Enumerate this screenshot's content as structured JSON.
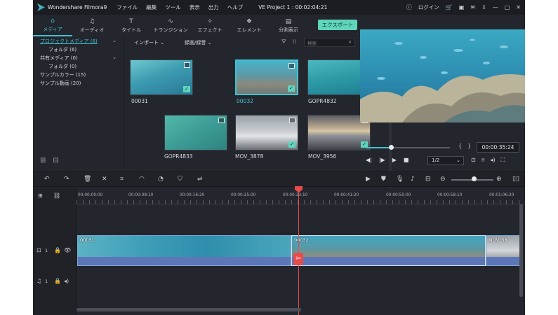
{
  "app": {
    "name": "Wondershare Filmora9",
    "project": "VE Project 1 : 00:02:04:21"
  },
  "menu": [
    "ファイル",
    "編集",
    "ツール",
    "表示",
    "出力",
    "ヘルプ"
  ],
  "titlebar_right": {
    "login": "ログイン"
  },
  "media_tabs": [
    {
      "label": "メディア",
      "icon": "folder-icon"
    },
    {
      "label": "オーディオ",
      "icon": "music-note-icon"
    },
    {
      "label": "タイトル",
      "icon": "text-icon"
    },
    {
      "label": "トランジション",
      "icon": "transition-icon"
    },
    {
      "label": "エフェクト",
      "icon": "effect-icon"
    },
    {
      "label": "エレメント",
      "icon": "element-icon"
    },
    {
      "label": "分割表示",
      "icon": "split-screen-icon"
    }
  ],
  "export_label": "エクスポート",
  "library": [
    {
      "label": "プロジェクトメディア (6)",
      "selected": true,
      "sub": false
    },
    {
      "label": "フォルダ (6)",
      "selected": false,
      "sub": true
    },
    {
      "label": "共有メディア (0)",
      "selected": false,
      "sub": false
    },
    {
      "label": "フォルダ (0)",
      "selected": false,
      "sub": true
    },
    {
      "label": "サンプルカラー (15)",
      "selected": false,
      "sub": false
    },
    {
      "label": "サンプル動画 (20)",
      "selected": false,
      "sub": false
    }
  ],
  "browser": {
    "import_label": "インポート",
    "record_label": "録画/録音",
    "search_placeholder": "検索",
    "items": [
      {
        "name": "00031",
        "selected": false,
        "checked": true,
        "theme": "underwater-divers"
      },
      {
        "name": "00032",
        "selected": true,
        "checked": true,
        "theme": "coral-reef"
      },
      {
        "name": "GOPR4832",
        "selected": false,
        "checked": false,
        "theme": "turquoise-water"
      },
      {
        "name": "GOPR4833",
        "selected": false,
        "checked": false,
        "theme": "shallow-reef"
      },
      {
        "name": "MOV_3878",
        "selected": false,
        "checked": true,
        "theme": "clouds-mountains"
      },
      {
        "name": "MOV_3956",
        "selected": false,
        "checked": true,
        "theme": "sunset-clouds"
      }
    ]
  },
  "preview": {
    "timecode": "00:00:35:24",
    "ratio": "1/2",
    "progress": 0.3
  },
  "ruler": [
    "00:00:00:00",
    "00:00:08:10",
    "00:00:16:20",
    "00:00:25:00",
    "00:00:33:10",
    "00:00:41:20",
    "00:00:50:00",
    "00:00:58:10",
    "00:01:06:20"
  ],
  "tracks": {
    "video_label": "1",
    "audio_label": "1"
  },
  "clips": [
    {
      "label": "00031"
    },
    {
      "label": "00032"
    },
    {
      "label": "MOV_38"
    }
  ],
  "colors": {
    "accent": "#3fc4d3",
    "export": "#5fd5bb",
    "playhead": "#e84b4b",
    "audio": "#5c76b8"
  }
}
